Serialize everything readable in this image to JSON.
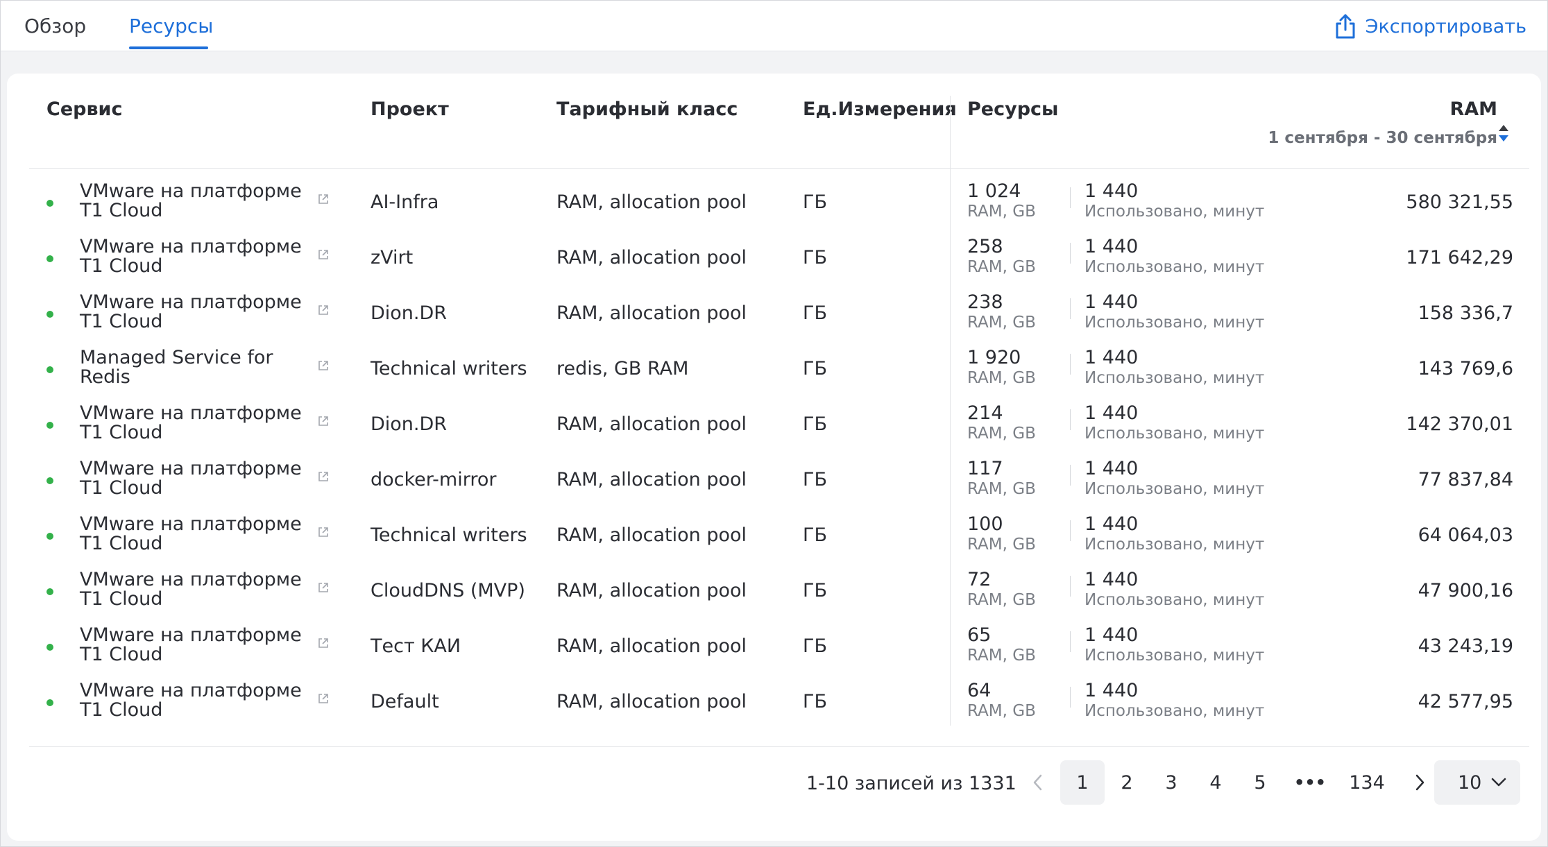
{
  "tabs": [
    {
      "label": "Обзор",
      "active": false
    },
    {
      "label": "Ресурсы",
      "active": true
    }
  ],
  "export_label": "Экспортировать",
  "table": {
    "headers": {
      "service": "Сервис",
      "project": "Проект",
      "tariff": "Тарифный класс",
      "unit": "Ед.Измерения",
      "resources": "Ресурсы",
      "ram": "RAM",
      "ram_period": "1 сентября - 30 сентября"
    },
    "rows": [
      {
        "service_line1": "VMware на платформе",
        "service_line2": "T1 Cloud",
        "project": "AI-Infra",
        "tariff": "RAM, allocation pool",
        "unit": "ГБ",
        "res_value": "1 024",
        "res_label": "RAM, GB",
        "minutes_value": "1 440",
        "minutes_label": "Использовано, минут",
        "ram": "580 321,55"
      },
      {
        "service_line1": "VMware на платформе",
        "service_line2": "T1 Cloud",
        "project": "zVirt",
        "tariff": "RAM, allocation pool",
        "unit": "ГБ",
        "res_value": "258",
        "res_label": "RAM, GB",
        "minutes_value": "1 440",
        "minutes_label": "Использовано, минут",
        "ram": "171 642,29"
      },
      {
        "service_line1": "VMware на платформе",
        "service_line2": "T1 Cloud",
        "project": "Dion.DR",
        "tariff": "RAM, allocation pool",
        "unit": "ГБ",
        "res_value": "238",
        "res_label": "RAM, GB",
        "minutes_value": "1 440",
        "minutes_label": "Использовано, минут",
        "ram": "158 336,7"
      },
      {
        "service_line1": "Managed Service for",
        "service_line2": "Redis",
        "project": "Technical writers",
        "tariff": "redis, GB RAM",
        "unit": "ГБ",
        "res_value": "1 920",
        "res_label": "RAM, GB",
        "minutes_value": "1 440",
        "minutes_label": "Использовано, минут",
        "ram": "143 769,6"
      },
      {
        "service_line1": "VMware на платформе",
        "service_line2": "T1 Cloud",
        "project": "Dion.DR",
        "tariff": "RAM, allocation pool",
        "unit": "ГБ",
        "res_value": "214",
        "res_label": "RAM, GB",
        "minutes_value": "1 440",
        "minutes_label": "Использовано, минут",
        "ram": "142 370,01"
      },
      {
        "service_line1": "VMware на платформе",
        "service_line2": "T1 Cloud",
        "project": "docker-mirror",
        "tariff": "RAM, allocation pool",
        "unit": "ГБ",
        "res_value": "117",
        "res_label": "RAM, GB",
        "minutes_value": "1 440",
        "minutes_label": "Использовано, минут",
        "ram": "77 837,84"
      },
      {
        "service_line1": "VMware на платформе",
        "service_line2": "T1 Cloud",
        "project": "Technical writers",
        "tariff": "RAM, allocation pool",
        "unit": "ГБ",
        "res_value": "100",
        "res_label": "RAM, GB",
        "minutes_value": "1 440",
        "minutes_label": "Использовано, минут",
        "ram": "64 064,03"
      },
      {
        "service_line1": "VMware на платформе",
        "service_line2": "T1 Cloud",
        "project": "CloudDNS (MVP)",
        "tariff": "RAM, allocation pool",
        "unit": "ГБ",
        "res_value": "72",
        "res_label": "RAM, GB",
        "minutes_value": "1 440",
        "minutes_label": "Использовано, минут",
        "ram": "47 900,16"
      },
      {
        "service_line1": "VMware на платформе",
        "service_line2": "T1 Cloud",
        "project": "Тест КАИ",
        "tariff": "RAM, allocation pool",
        "unit": "ГБ",
        "res_value": "65",
        "res_label": "RAM, GB",
        "minutes_value": "1 440",
        "minutes_label": "Использовано, минут",
        "ram": "43 243,19"
      },
      {
        "service_line1": "VMware на платформе",
        "service_line2": "T1 Cloud",
        "project": "Default",
        "tariff": "RAM, allocation pool",
        "unit": "ГБ",
        "res_value": "64",
        "res_label": "RAM, GB",
        "minutes_value": "1 440",
        "minutes_label": "Использовано, минут",
        "ram": "42 577,95"
      }
    ]
  },
  "pagination": {
    "summary": "1-10 записей из 1331",
    "pages": [
      "1",
      "2",
      "3",
      "4",
      "5"
    ],
    "ellipsis": "•••",
    "last_page": "134",
    "per_page": "10"
  },
  "icons": {
    "export": "share-upload-icon",
    "external": "external-link-icon",
    "sort": "sort-arrows-icon",
    "prev": "chevron-left-icon",
    "next": "chevron-right-icon",
    "dropdown": "chevron-down-icon"
  },
  "colors": {
    "accent": "#1e6fd9",
    "status_active": "#33b14a"
  }
}
